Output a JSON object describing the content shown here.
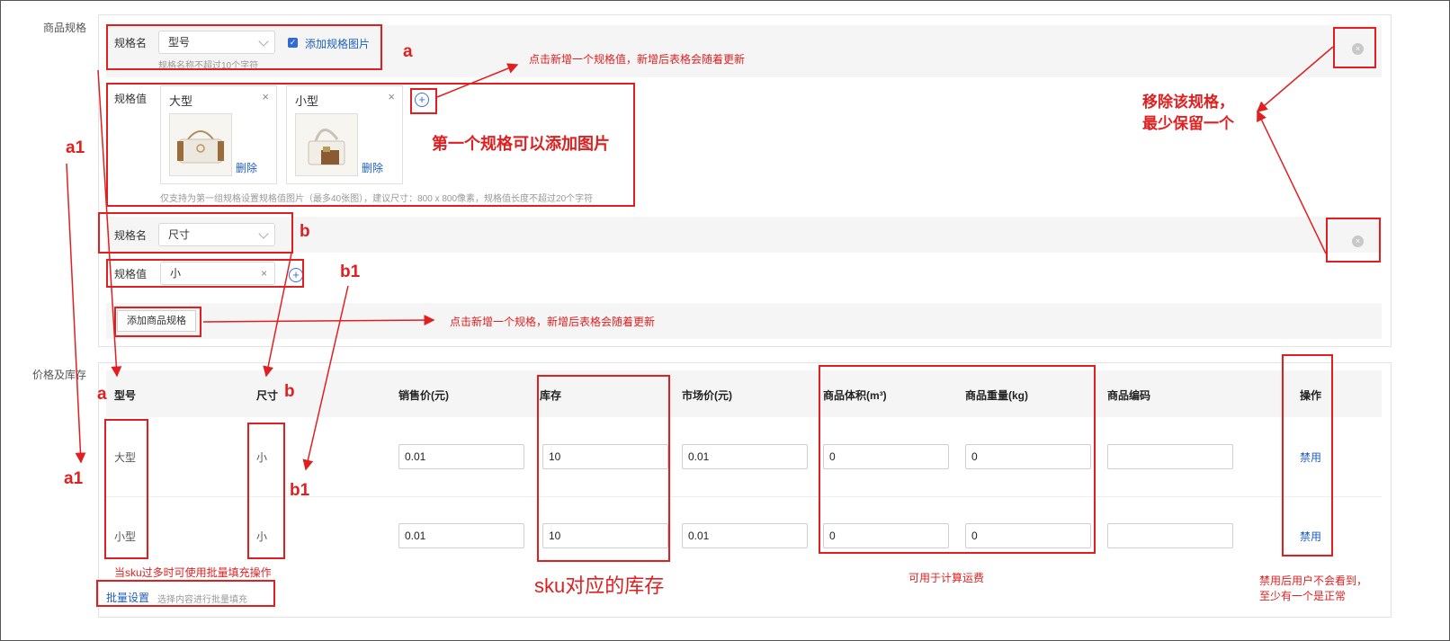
{
  "spec_section_label": "商品规格",
  "price_section_label": "价格及库存",
  "spec1": {
    "name_label": "规格名",
    "name_value": "型号",
    "add_image_label": "添加规格图片",
    "name_hint": "规格名称不超过10个字符",
    "value_label": "规格值",
    "values": [
      {
        "name": "大型",
        "delete": "删除",
        "close": "×"
      },
      {
        "name": "小型",
        "delete": "删除",
        "close": "×"
      }
    ],
    "value_hint": "仅支持为第一组规格设置规格值图片（最多40张图），建议尺寸：800 x 800像素，规格值长度不超过20个字符"
  },
  "spec2": {
    "name_label": "规格名",
    "name_value": "尺寸",
    "value_label": "规格值",
    "value": "小",
    "close": "×"
  },
  "add_spec_button": "添加商品规格",
  "plus_glyph": "+",
  "remove_glyph": "×",
  "check_glyph": "✓",
  "table": {
    "headers": [
      "型号",
      "尺寸",
      "销售价(元)",
      "库存",
      "市场价(元)",
      "商品体积(m³)",
      "商品重量(kg)",
      "商品编码",
      "操作"
    ],
    "rows": [
      {
        "model": "大型",
        "size": "小",
        "price": "0.01",
        "stock": "10",
        "market": "0.01",
        "volume": "0",
        "weight": "0",
        "code": "",
        "action": "禁用"
      },
      {
        "model": "小型",
        "size": "小",
        "price": "0.01",
        "stock": "10",
        "market": "0.01",
        "volume": "0",
        "weight": "0",
        "code": "",
        "action": "禁用"
      }
    ]
  },
  "batch": {
    "link": "批量设置",
    "hint": "选择内容进行批量填充"
  },
  "annotations": {
    "add_value_note": "点击新增一个规格值，新增后表格会随着更新",
    "first_spec_image": "第一个规格可以添加图片",
    "remove_spec": "移除该规格，\n最少保留一个",
    "add_spec_note": "点击新增一个规格，新增后表格会随着更新",
    "batch_note": "当sku过多时可使用批量填充操作",
    "stock_note": "sku对应的库存",
    "shipping_note": "可用于计算运费",
    "disable_note": "禁用后用户不会看到，\n至少有一个是正常",
    "tag_a": "a",
    "tag_a1": "a1",
    "tag_b": "b",
    "tag_b1": "b1"
  },
  "colors": {
    "annotation_red": "#e02020",
    "link_blue": "#1e5fbf",
    "panel_gray": "#f5f5f5"
  }
}
